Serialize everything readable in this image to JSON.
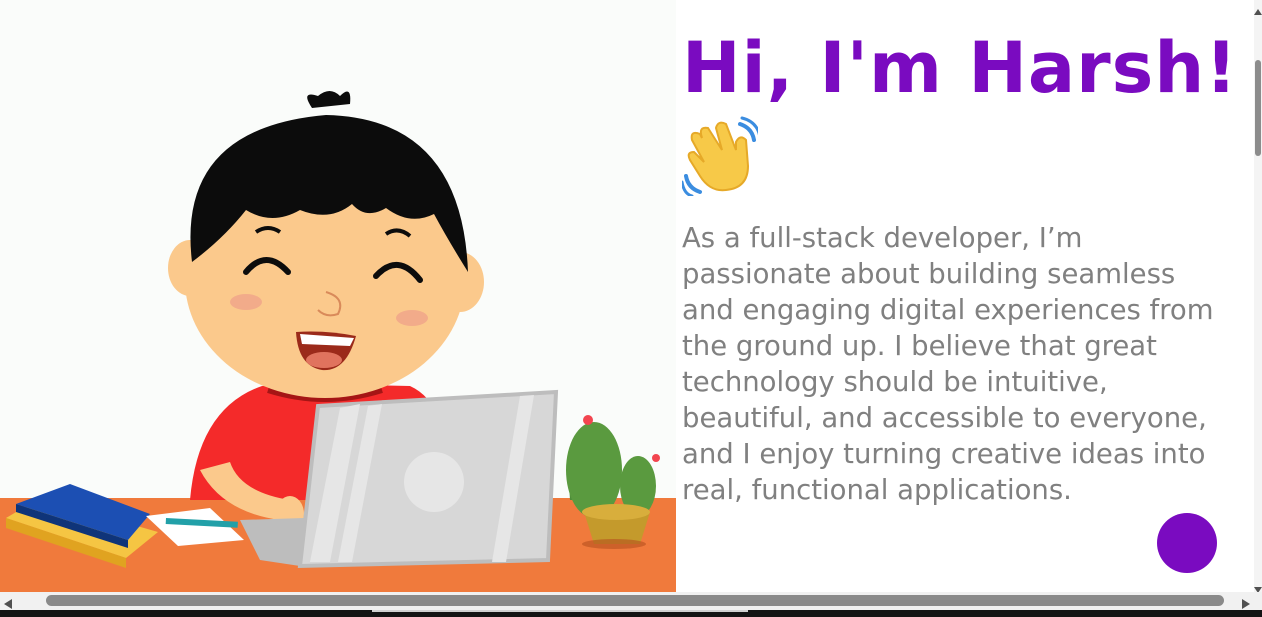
{
  "hero": {
    "title": "Hi, I'm Harsh!",
    "paragraph": "As a full-stack developer, I’m passionate about building seamless and engaging digital experiences from the ground up. I believe that great technology should be intuitive, beautiful, and accessible to everyone, and I enjoy turning creative ideas into real, functional applications.",
    "illustration": "boy-with-laptop-illustration",
    "wave_icon": "waving-hand-icon"
  },
  "colors": {
    "accent": "#7a0bc0",
    "body_text": "#808080",
    "desk": "#f07a3c",
    "shirt": "#f42a2a",
    "hair": "#0c0c0c",
    "skin": "#fbc98c"
  },
  "fab": {
    "icon": "circle-button"
  }
}
